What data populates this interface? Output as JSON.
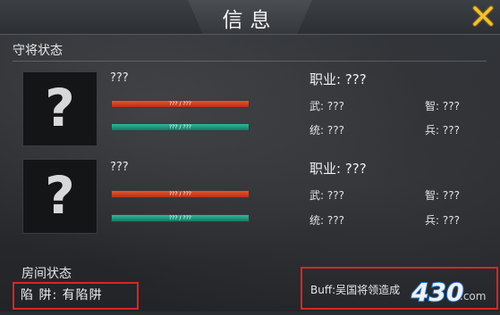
{
  "header": {
    "title": "信息"
  },
  "defender_section": {
    "title": "守将状态"
  },
  "generals": [
    {
      "portrait_icon": "question-mark-icon",
      "name": "???",
      "hp_text": "??? / ???",
      "hp_fill": 1.0,
      "troop_text": "??? / ???",
      "troop_fill": 1.0,
      "job": "职业: ???",
      "stats": {
        "wu": "武: ???",
        "zhi": "智: ???",
        "tong": "统: ???",
        "bing": "兵: ???"
      }
    },
    {
      "portrait_icon": "question-mark-icon",
      "name": "???",
      "hp_text": "??? / ???",
      "hp_fill": 1.0,
      "troop_text": "??? / ???",
      "troop_fill": 1.0,
      "job": "职业: ???",
      "stats": {
        "wu": "武: ???",
        "zhi": "智: ???",
        "tong": "统: ???",
        "bing": "兵: ???"
      }
    }
  ],
  "room_section": {
    "title": "房间状态",
    "status_text": "陷 阱:  有陷阱",
    "buff_text": "Buff:吴国将领造成"
  },
  "watermark": {
    "text": "430",
    "suffix": ".com"
  },
  "colors": {
    "accent_close": "#e2b531",
    "hp": "#d8421f",
    "troop": "#1f9a7e",
    "highlight": "#d92525"
  }
}
